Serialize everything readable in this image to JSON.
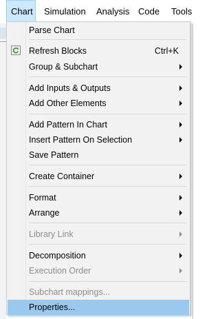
{
  "menubar": {
    "items": [
      {
        "label": "Chart",
        "underline": "C"
      },
      {
        "label": "Simulation",
        "underline": "S"
      },
      {
        "label": "Analysis",
        "underline": "A"
      },
      {
        "label": "Code",
        "underline": "C"
      },
      {
        "label": "Tools",
        "underline": "T"
      }
    ]
  },
  "menu": {
    "items": [
      {
        "label": "Parse Chart"
      },
      {
        "label": "Refresh Blocks",
        "shortcut": "Ctrl+K",
        "icon": "refresh-icon"
      },
      {
        "label": "Group & Subchart"
      },
      {
        "label": "Add Inputs & Outputs"
      },
      {
        "label": "Add Other Elements"
      },
      {
        "label": "Add Pattern In Chart"
      },
      {
        "label": "Insert Pattern On Selection"
      },
      {
        "label": "Save Pattern"
      },
      {
        "label": "Create Container"
      },
      {
        "label": "Format"
      },
      {
        "label": "Arrange"
      },
      {
        "label": "Library Link"
      },
      {
        "label": "Decomposition"
      },
      {
        "label": "Execution Order"
      },
      {
        "label": "Subchart mappings..."
      },
      {
        "label": "Properties..."
      }
    ]
  },
  "colors": {
    "menu_background": "#f2f2f2",
    "highlight": "#99c9ef",
    "active_menubar": "#cce8ff",
    "disabled_text": "#8d8d8d"
  }
}
